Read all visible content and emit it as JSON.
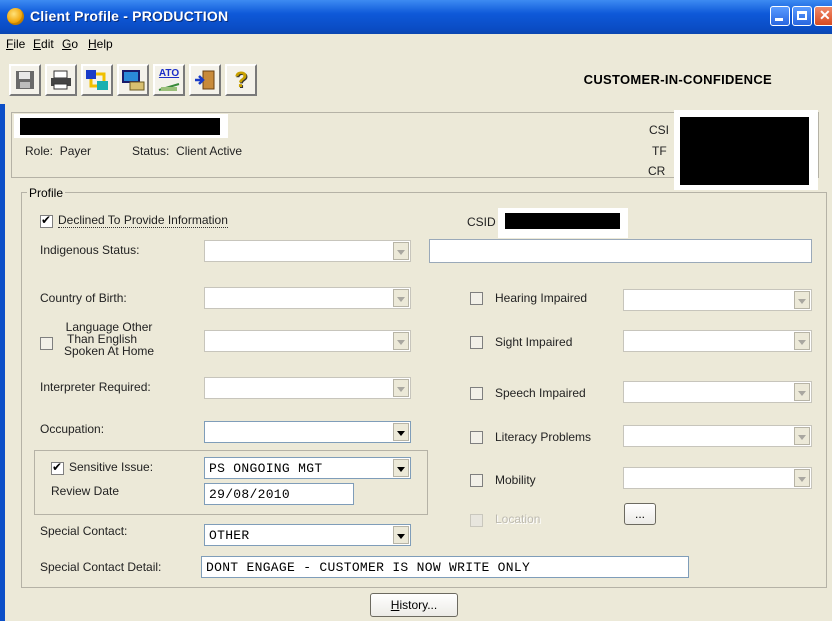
{
  "window": {
    "title": "Client Profile - PRODUCTION"
  },
  "menu": {
    "items": [
      {
        "label": "File",
        "accel": "F",
        "rest": "ile"
      },
      {
        "label": "Edit",
        "accel": "E",
        "rest": "dit"
      },
      {
        "label": "Go",
        "accel": "G",
        "rest": "o"
      },
      {
        "label": "Help",
        "accel": "H",
        "rest": "elp"
      }
    ]
  },
  "toolbar": {
    "ato_label": "ATO",
    "help_glyph": "?",
    "classification": "CUSTOMER-IN-CONFIDENCE"
  },
  "header": {
    "role_label": "Role:",
    "role_value": "Payer",
    "status_label": "Status:",
    "status_value": "Client Active",
    "right_label_1": "CSI",
    "right_label_2": "TF",
    "right_label_3": "CR"
  },
  "profile": {
    "legend": "Profile",
    "declined_label": "Declined To Provide Information",
    "declined_checked": true,
    "csid_label": "CSID",
    "indigenous_label": "Indigenous Status:",
    "indigenous_value": "",
    "country_label": "Country of Birth:",
    "country_value": "",
    "language_label_1": "Language Other",
    "language_label_2": "Than English",
    "language_label_3": "Spoken At Home",
    "language_checked": false,
    "interpreter_label": "Interpreter Required:",
    "occupation_label": "Occupation:",
    "occupation_value": "",
    "sensitive_label": "Sensitive Issue:",
    "sensitive_checked": true,
    "sensitive_value": "PS ONGOING MGT",
    "review_label": "Review Date",
    "review_value": "29/08/2010",
    "special_contact_label": "Special Contact:",
    "special_contact_value": "OTHER",
    "special_contact_detail_label": "Special Contact Detail:",
    "special_contact_detail_value": "DONT ENGAGE - CUSTOMER IS NOW WRITE ONLY",
    "hearing_label": "Hearing Impaired",
    "sight_label": "Sight Impaired",
    "speech_label": "Speech Impaired",
    "literacy_label": "Literacy Problems",
    "mobility_label": "Mobility",
    "location_label": "Location",
    "ellipsis_label": "...",
    "history_label": "History...",
    "history_accel": "H",
    "history_rest": "istory..."
  },
  "colors": {
    "titlebar": "#0E59D9",
    "background": "#ECE9D8"
  }
}
